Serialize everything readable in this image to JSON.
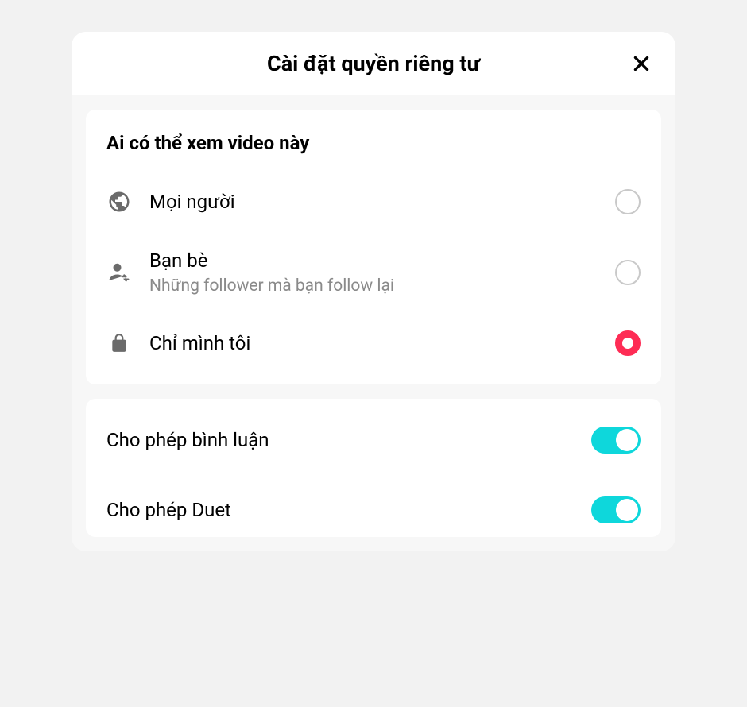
{
  "header": {
    "title": "Cài đặt quyền riêng tư"
  },
  "visibility": {
    "section_title": "Ai có thể xem video này",
    "options": [
      {
        "label": "Mọi người",
        "sublabel": "",
        "selected": false
      },
      {
        "label": "Bạn bè",
        "sublabel": "Những follower mà bạn follow lại",
        "selected": false
      },
      {
        "label": "Chỉ mình tôi",
        "sublabel": "",
        "selected": true
      }
    ]
  },
  "toggles": {
    "comments": {
      "label": "Cho phép bình luận",
      "on": true
    },
    "duet": {
      "label": "Cho phép Duet",
      "on": true
    }
  }
}
